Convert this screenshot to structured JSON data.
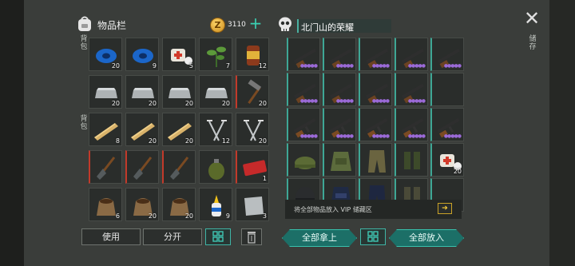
{
  "inventory": {
    "title": "物品栏",
    "coins": "3110",
    "side_label_top": "背包",
    "side_label_bottom": "背包",
    "items": [
      {
        "name": "blue-tape-icon",
        "qty": "20"
      },
      {
        "name": "blue-tape-icon",
        "qty": "9"
      },
      {
        "name": "medkit-icon",
        "qty": "5"
      },
      {
        "name": "herb-leaf-icon",
        "qty": "7"
      },
      {
        "name": "canned-food-icon",
        "qty": "12"
      },
      {
        "name": "metal-ingot-icon",
        "qty": "20"
      },
      {
        "name": "metal-ingot-icon",
        "qty": "20"
      },
      {
        "name": "metal-ingot-icon",
        "qty": "20"
      },
      {
        "name": "metal-ingot-icon",
        "qty": "20"
      },
      {
        "name": "hammer-icon",
        "qty": "20"
      },
      {
        "name": "wood-plank-icon",
        "qty": "8"
      },
      {
        "name": "wood-plank-icon",
        "qty": "20"
      },
      {
        "name": "wood-plank-icon",
        "qty": "20"
      },
      {
        "name": "nails-icon",
        "qty": "12"
      },
      {
        "name": "nails-icon",
        "qty": "20"
      },
      {
        "name": "shovel-icon",
        "qty": ""
      },
      {
        "name": "shovel-icon",
        "qty": ""
      },
      {
        "name": "shovel-icon",
        "qty": ""
      },
      {
        "name": "grenade-icon",
        "qty": ""
      },
      {
        "name": "ticket-icon",
        "qty": "1"
      },
      {
        "name": "seed-sack-icon",
        "qty": "6"
      },
      {
        "name": "seed-sack-icon",
        "qty": "20"
      },
      {
        "name": "seed-sack-icon",
        "qty": "20"
      },
      {
        "name": "glue-bottle-icon",
        "qty": "9"
      },
      {
        "name": "metal-plate-icon",
        "qty": "3"
      }
    ]
  },
  "storage": {
    "location": "北门山的荣耀",
    "side_label": "储存",
    "items": [
      {
        "name": "shotgun-icon",
        "qty": ""
      },
      {
        "name": "shotgun-icon",
        "qty": ""
      },
      {
        "name": "shotgun-icon",
        "qty": ""
      },
      {
        "name": "shotgun-icon",
        "qty": ""
      },
      {
        "name": "shotgun-icon",
        "qty": ""
      },
      {
        "name": "shotgun-icon",
        "qty": ""
      },
      {
        "name": "shotgun-icon",
        "qty": ""
      },
      {
        "name": "shotgun-icon",
        "qty": ""
      },
      {
        "name": "shotgun-icon",
        "qty": ""
      },
      {
        "name": "empty-slot",
        "qty": ""
      },
      {
        "name": "assault-rifle-icon",
        "qty": ""
      },
      {
        "name": "assault-rifle-icon",
        "qty": ""
      },
      {
        "name": "assault-rifle-icon",
        "qty": ""
      },
      {
        "name": "assault-rifle-icon",
        "qty": ""
      },
      {
        "name": "assault-rifle-icon",
        "qty": ""
      },
      {
        "name": "military-cap-icon",
        "qty": ""
      },
      {
        "name": "body-armor-icon",
        "qty": ""
      },
      {
        "name": "camo-pants-icon",
        "qty": ""
      },
      {
        "name": "military-boots-icon",
        "qty": ""
      },
      {
        "name": "medkit-icon",
        "qty": "20"
      },
      {
        "name": "helmet-icon",
        "qty": ""
      },
      {
        "name": "police-vest-icon",
        "qty": ""
      },
      {
        "name": "police-pants-icon",
        "qty": ""
      },
      {
        "name": "boots-icon",
        "qty": ""
      },
      {
        "name": "empty-slot",
        "qty": ""
      }
    ],
    "vip_hint": "将全部物品放入 VIP 储藏区"
  },
  "buttons": {
    "use": "使用",
    "split": "分开",
    "take_all": "全部拿上",
    "put_all": "全部放入"
  },
  "colors": {
    "accent": "#3fb5a6",
    "rarity": "#9b6ad8",
    "coin": "#e6a93a"
  }
}
